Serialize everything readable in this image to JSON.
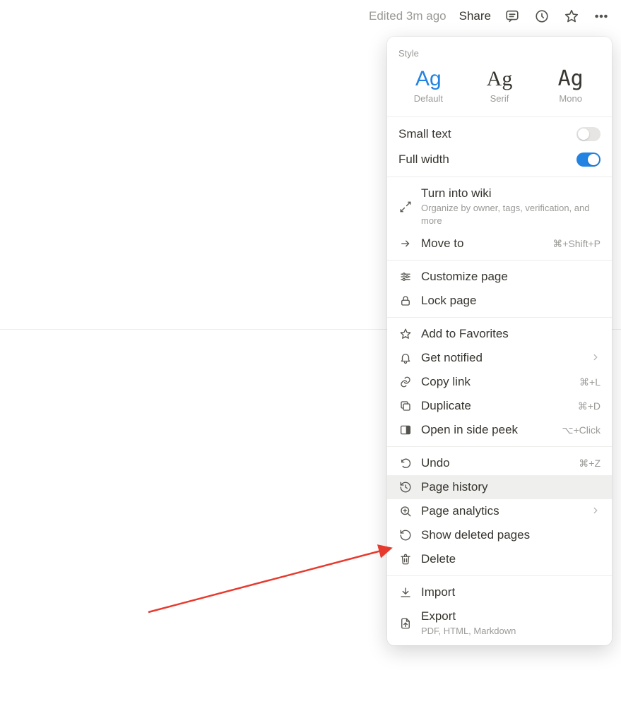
{
  "topbar": {
    "edited": "Edited 3m ago",
    "share": "Share"
  },
  "panel": {
    "style_label": "Style",
    "styles": {
      "default": {
        "sample": "Ag",
        "label": "Default"
      },
      "serif": {
        "sample": "Ag",
        "label": "Serif"
      },
      "mono": {
        "sample": "Ag",
        "label": "Mono"
      }
    },
    "toggles": {
      "small_text": {
        "label": "Small text",
        "on": false
      },
      "full_width": {
        "label": "Full width",
        "on": true
      }
    },
    "items": {
      "wiki": {
        "label": "Turn into wiki",
        "sub": "Organize by owner, tags, verification, and more"
      },
      "move": {
        "label": "Move to",
        "shortcut": "⌘+Shift+P"
      },
      "customize": {
        "label": "Customize page"
      },
      "lock": {
        "label": "Lock page"
      },
      "favorites": {
        "label": "Add to Favorites"
      },
      "notified": {
        "label": "Get notified"
      },
      "copylink": {
        "label": "Copy link",
        "shortcut": "⌘+L"
      },
      "duplicate": {
        "label": "Duplicate",
        "shortcut": "⌘+D"
      },
      "sidepeek": {
        "label": "Open in side peek",
        "shortcut": "⌥+Click"
      },
      "undo": {
        "label": "Undo",
        "shortcut": "⌘+Z"
      },
      "history": {
        "label": "Page history"
      },
      "analytics": {
        "label": "Page analytics"
      },
      "deleted": {
        "label": "Show deleted pages"
      },
      "delete": {
        "label": "Delete"
      },
      "import": {
        "label": "Import"
      },
      "export": {
        "label": "Export",
        "sub": "PDF, HTML, Markdown"
      }
    }
  }
}
